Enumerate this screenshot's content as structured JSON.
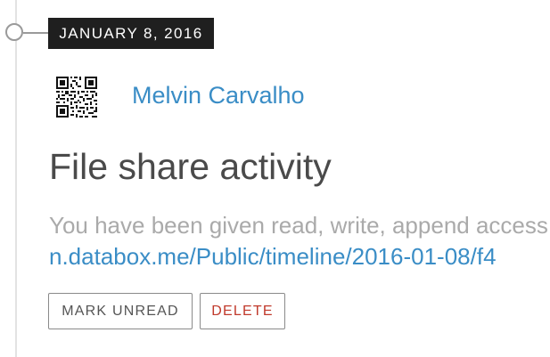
{
  "entry": {
    "date": "JANUARY 8, 2016",
    "author": "Melvin Carvalho",
    "title": "File share activity",
    "message": "You have been given read, write, append access to a file",
    "link": "n.databox.me/Public/timeline/2016-01-08/f4",
    "actions": {
      "mark_unread": "MARK UNREAD",
      "delete": "DELETE"
    }
  },
  "colors": {
    "accent": "#3a8dc6",
    "danger": "#c0392b",
    "badge_bg": "#1f1f1f"
  }
}
